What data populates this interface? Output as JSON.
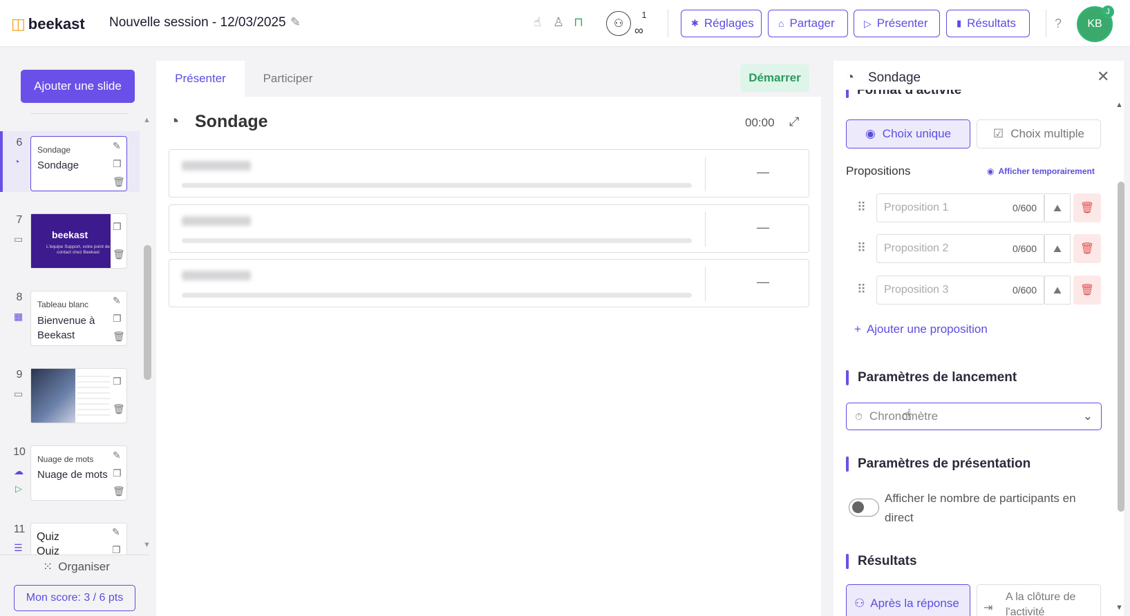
{
  "header": {
    "logo": "beekast",
    "session_title": "Nouvelle session - 12/03/2025",
    "participants_count": "1",
    "participants_max": "∞",
    "buttons": {
      "settings": "Réglages",
      "share": "Partager",
      "present": "Présenter",
      "results": "Résultats"
    },
    "help": "?",
    "avatar_initials": "KB",
    "avatar_badge": "J"
  },
  "sidebar": {
    "add_slide": "Ajouter une slide",
    "slides": [
      {
        "number": "6",
        "type": "Sondage",
        "name": "Sondage"
      },
      {
        "number": "7",
        "thumb_brand": "beekast",
        "thumb_text": "L'équipe Support, votre point de contact chez Beekast"
      },
      {
        "number": "8",
        "type": "Tableau blanc",
        "name": "Bienvenue à Beekast"
      },
      {
        "number": "9"
      },
      {
        "number": "10",
        "type": "Nuage de mots",
        "name": "Nuage de mots"
      },
      {
        "number": "11",
        "type": "Quiz",
        "name": "Quiz"
      }
    ],
    "organize": "Organiser",
    "score": "Mon score: 3 / 6 pts"
  },
  "main": {
    "tabs": [
      "Présenter",
      "Participer"
    ],
    "start": "Démarrer",
    "activity_title": "Sondage",
    "timer": "00:00",
    "propositions": [
      {
        "label": "Proposition1",
        "value": "—"
      },
      {
        "label": "Proposition2",
        "value": "—"
      },
      {
        "label": "Proposition3",
        "value": "—"
      }
    ]
  },
  "panel": {
    "title": "Sondage",
    "cut_heading": "Format d'activité",
    "choice_single": "Choix unique",
    "choice_multiple": "Choix multiple",
    "propositions_label": "Propositions",
    "show_temp": "Afficher temporairement",
    "inputs": [
      {
        "placeholder": "Proposition 1",
        "count": "0/600"
      },
      {
        "placeholder": "Proposition 2",
        "count": "0/600"
      },
      {
        "placeholder": "Proposition 3",
        "count": "0/600"
      }
    ],
    "add_proposition": "Ajouter une proposition",
    "launch_params": "Paramètres de lancement",
    "timer_select": "Chronomètre",
    "presentation_params": "Paramètres de présentation",
    "live_participants": "Afficher le nombre de participants en direct",
    "live_participants_enabled": false,
    "results_heading": "Résultats",
    "after_answer": "Après la réponse",
    "at_close": "A la clôture de l'activité"
  },
  "colors": {
    "accent": "#5b4de0",
    "add_button": "#6a50e8",
    "start_bg": "#dff5ea",
    "start_text": "#2c9a5f",
    "delete_bg": "#fde8e8",
    "delete_icon": "#e25353",
    "avatar": "#3aa96b",
    "logo_mark": "#f4a21b"
  },
  "icons": [
    "edit-icon",
    "hand-icon",
    "user-icon",
    "lock-icon",
    "participants-icon",
    "gear-icon",
    "share-icon",
    "play-icon",
    "chart-icon",
    "help-icon",
    "pie-icon",
    "expand-icon",
    "close-icon",
    "copy-icon",
    "trash-icon",
    "drag-icon",
    "image-icon",
    "plus-icon",
    "stopwatch-icon",
    "chevron-down-icon",
    "eye-icon",
    "grid-icon",
    "radio-icon",
    "checkbox-icon",
    "arrow-right-icon",
    "group-icon"
  ]
}
